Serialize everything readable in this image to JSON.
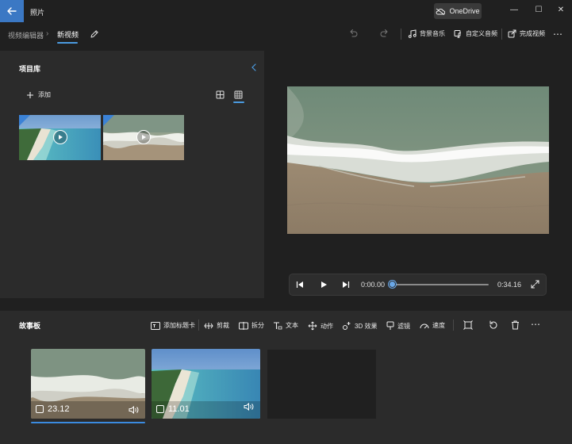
{
  "window": {
    "app_title": "照片",
    "onedrive_label": "OneDrive",
    "controls": {
      "minimize": "—",
      "maximize": "☐",
      "close": "✕"
    }
  },
  "header": {
    "breadcrumb_root": "视频编辑器",
    "breadcrumb_separator": "›",
    "project_name": "新视频",
    "background_music": "背景音乐",
    "custom_audio": "自定义音频",
    "finish_video": "完成视频",
    "more": "⋯"
  },
  "library": {
    "title": "项目库",
    "add_label": "添加"
  },
  "player": {
    "current_time": "0:00.00",
    "total_time": "0:34.16",
    "progress": 0.0
  },
  "storyboard": {
    "title": "故事板",
    "tools": {
      "add_title_card": "添加标题卡",
      "trim": "剪裁",
      "split": "拆分",
      "text": "文本",
      "motion": "动作",
      "effects_3d": "3D 效果",
      "filters": "滤镜",
      "speed": "速度"
    },
    "more": "⋯",
    "clips": [
      {
        "duration": "23.12"
      },
      {
        "duration": "11.01"
      }
    ]
  },
  "colors": {
    "accent": "#4b9be0",
    "back_button": "#3b78c4",
    "panel": "#2b2b2b",
    "background": "#202020"
  }
}
